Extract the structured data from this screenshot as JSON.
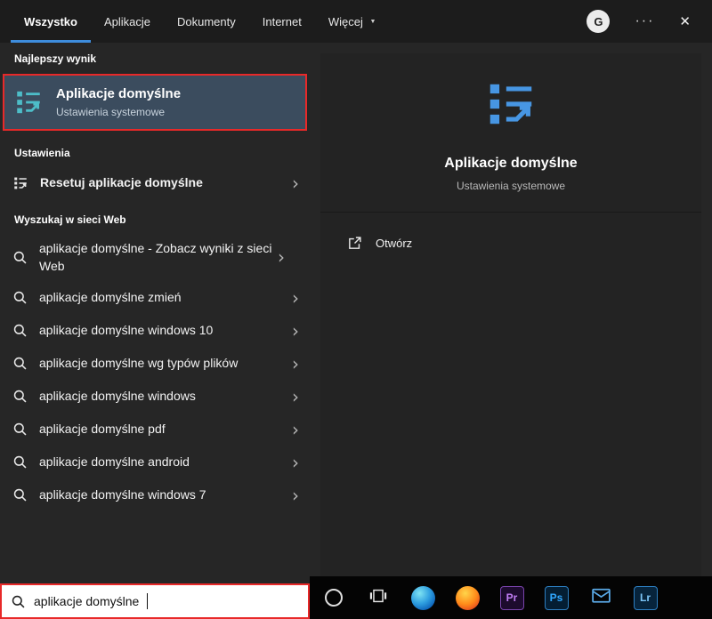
{
  "topbar": {
    "tabs": [
      {
        "label": "Wszystko"
      },
      {
        "label": "Aplikacje"
      },
      {
        "label": "Dokumenty"
      },
      {
        "label": "Internet"
      },
      {
        "label": "Więcej"
      }
    ],
    "more_caret": "▼",
    "avatar_initial": "G",
    "overflow": "···",
    "close": "✕"
  },
  "left": {
    "best_match_header": "Najlepszy wynik",
    "best_match": {
      "title": "Aplikacje domyślne",
      "subtitle": "Ustawienia systemowe"
    },
    "settings_header": "Ustawienia",
    "settings_item": "Resetuj aplikacje domyślne",
    "web_header": "Wyszukaj w sieci Web",
    "web_first": "aplikacje domyślne - Zobacz wyniki z sieci Web",
    "suggestions": [
      "aplikacje domyślne zmień",
      "aplikacje domyślne windows 10",
      "aplikacje domyślne wg typów plików",
      "aplikacje domyślne windows",
      "aplikacje domyślne pdf",
      "aplikacje domyślne android",
      "aplikacje domyślne windows 7"
    ],
    "chevron": "›"
  },
  "preview": {
    "title": "Aplikacje domyślne",
    "subtitle": "Ustawienia systemowe",
    "action": "Otwórz"
  },
  "search": {
    "value": "aplikacje domyślne"
  },
  "taskbar": {
    "icons": [
      {
        "name": "cortana"
      },
      {
        "name": "task-view"
      },
      {
        "name": "edge"
      },
      {
        "name": "firefox"
      },
      {
        "name": "premiere",
        "label": "Pr"
      },
      {
        "name": "photoshop",
        "label": "Ps"
      },
      {
        "name": "mail"
      },
      {
        "name": "lightroom",
        "label": "Lr"
      }
    ]
  },
  "colors": {
    "accent_underline": "#3e8ddd",
    "annotation_red": "#e82929",
    "best_match_highlight": "#3b4c5e",
    "small_app_icon": "#4dbdc8",
    "large_app_icon": "#4796e3"
  }
}
